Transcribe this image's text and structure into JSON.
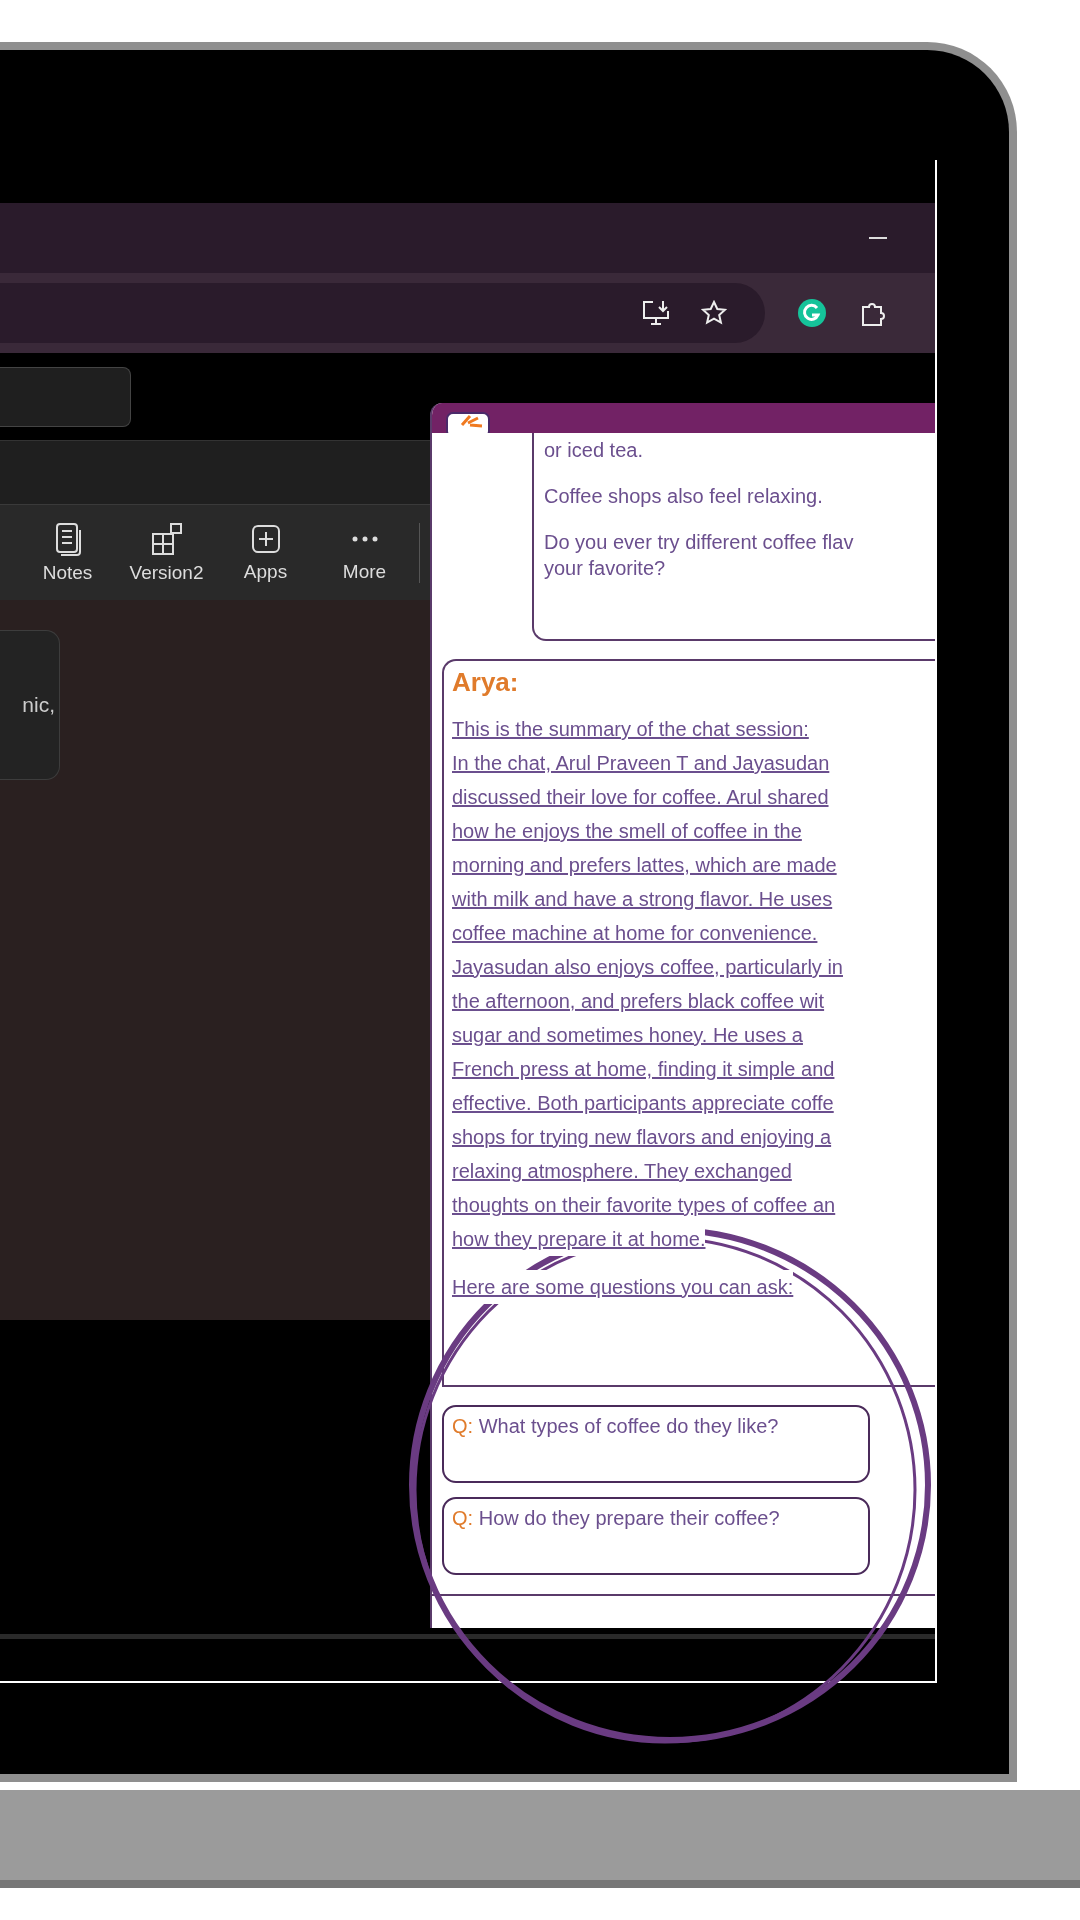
{
  "teams_toolbar": [
    {
      "kind": "notes",
      "label": "Notes"
    },
    {
      "kind": "version",
      "label": "Version2"
    },
    {
      "kind": "apps",
      "label": "Apps"
    },
    {
      "kind": "more",
      "label": "More"
    }
  ],
  "card_text": "nic,",
  "chat": {
    "previous_message": [
      [
        "or iced tea."
      ],
      [
        "Coffee shops also feel relaxing."
      ],
      [
        "Do you ever try different coffee flav",
        "your favorite?"
      ]
    ],
    "bot_name": "Arya:",
    "summary_lines": [
      "This is the summary of the chat session:",
      "In the chat, Arul Praveen T and Jayasudan",
      "discussed their love for coffee. Arul shared",
      "how he enjoys the smell of coffee in the",
      "morning and prefers lattes, which are made",
      "with milk and have a strong flavor. He uses",
      "coffee machine at home for convenience.",
      "Jayasudan also enjoys coffee, particularly in",
      "the afternoon, and prefers black coffee wit",
      "sugar and sometimes honey. He uses a",
      "French press at home, finding it simple and",
      "effective. Both participants appreciate coffe",
      "shops for trying new flavors and enjoying a",
      "relaxing atmosphere. They exchanged",
      "thoughts on their favorite types of coffee an",
      "how they prepare it at home."
    ],
    "prompt": "Here are some questions you can ask:",
    "questions": [
      {
        "prefix": "Q:",
        "text": "What types of coffee do they like?"
      },
      {
        "prefix": "Q:",
        "text": "How do they prepare their coffee?"
      }
    ]
  }
}
